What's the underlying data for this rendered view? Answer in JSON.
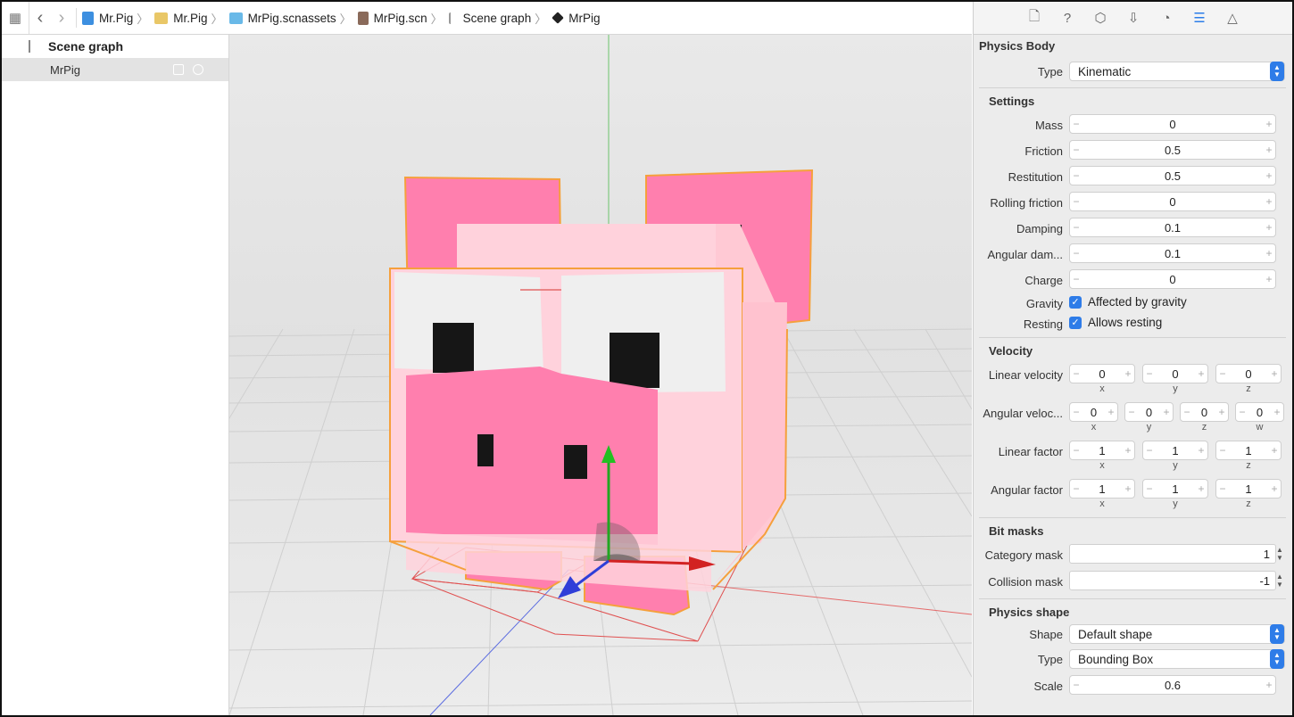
{
  "breadcrumb": [
    {
      "label": "Mr.Pig",
      "icon": "project-file-icon"
    },
    {
      "label": "Mr.Pig",
      "icon": "folder-icon"
    },
    {
      "label": "MrPig.scnassets",
      "icon": "asset-folder-icon"
    },
    {
      "label": "MrPig.scn",
      "icon": "scene-file-icon"
    },
    {
      "label": "Scene graph",
      "icon": "scene-graph-icon"
    },
    {
      "label": "MrPig",
      "icon": "node-cube-icon"
    }
  ],
  "scene_graph": {
    "title": "Scene graph",
    "nodes": [
      {
        "label": "MrPig",
        "selected": true
      }
    ]
  },
  "inspector": {
    "tabs": [
      "file-icon",
      "help-icon",
      "cube-icon",
      "attributes-icon",
      "material-icon",
      "physics-icon",
      "scene-icon"
    ],
    "physics_body": {
      "title": "Physics Body",
      "type_label": "Type",
      "type_value": "Kinematic"
    },
    "settings": {
      "title": "Settings",
      "fields": [
        {
          "label": "Mass",
          "value": "0"
        },
        {
          "label": "Friction",
          "value": "0.5"
        },
        {
          "label": "Restitution",
          "value": "0.5"
        },
        {
          "label": "Rolling friction",
          "value": "0"
        },
        {
          "label": "Damping",
          "value": "0.1"
        },
        {
          "label": "Angular dam...",
          "value": "0.1"
        },
        {
          "label": "Charge",
          "value": "0"
        }
      ],
      "gravity_label": "Gravity",
      "gravity_text": "Affected by gravity",
      "resting_label": "Resting",
      "resting_text": "Allows resting"
    },
    "velocity": {
      "title": "Velocity",
      "linear_velocity": {
        "label": "Linear velocity",
        "x": "0",
        "y": "0",
        "z": "0"
      },
      "angular_velocity": {
        "label": "Angular veloc...",
        "x": "0",
        "y": "0",
        "z": "0",
        "w": "0"
      },
      "linear_factor": {
        "label": "Linear factor",
        "x": "1",
        "y": "1",
        "z": "1"
      },
      "angular_factor": {
        "label": "Angular factor",
        "x": "1",
        "y": "1",
        "z": "1"
      },
      "axes": {
        "x": "x",
        "y": "y",
        "z": "z",
        "w": "w"
      }
    },
    "bit_masks": {
      "title": "Bit masks",
      "category_label": "Category mask",
      "category_value": "1",
      "collision_label": "Collision mask",
      "collision_value": "-1"
    },
    "physics_shape": {
      "title": "Physics shape",
      "shape_label": "Shape",
      "shape_value": "Default shape",
      "type_label": "Type",
      "type_value": "Bounding Box",
      "scale_label": "Scale",
      "scale_value": "0.6"
    }
  },
  "colors": {
    "accent": "#2e7ce8",
    "pig_pink": "#ff7fae",
    "pig_light": "#ffd2dc",
    "selection_outline": "#f5a03c"
  }
}
